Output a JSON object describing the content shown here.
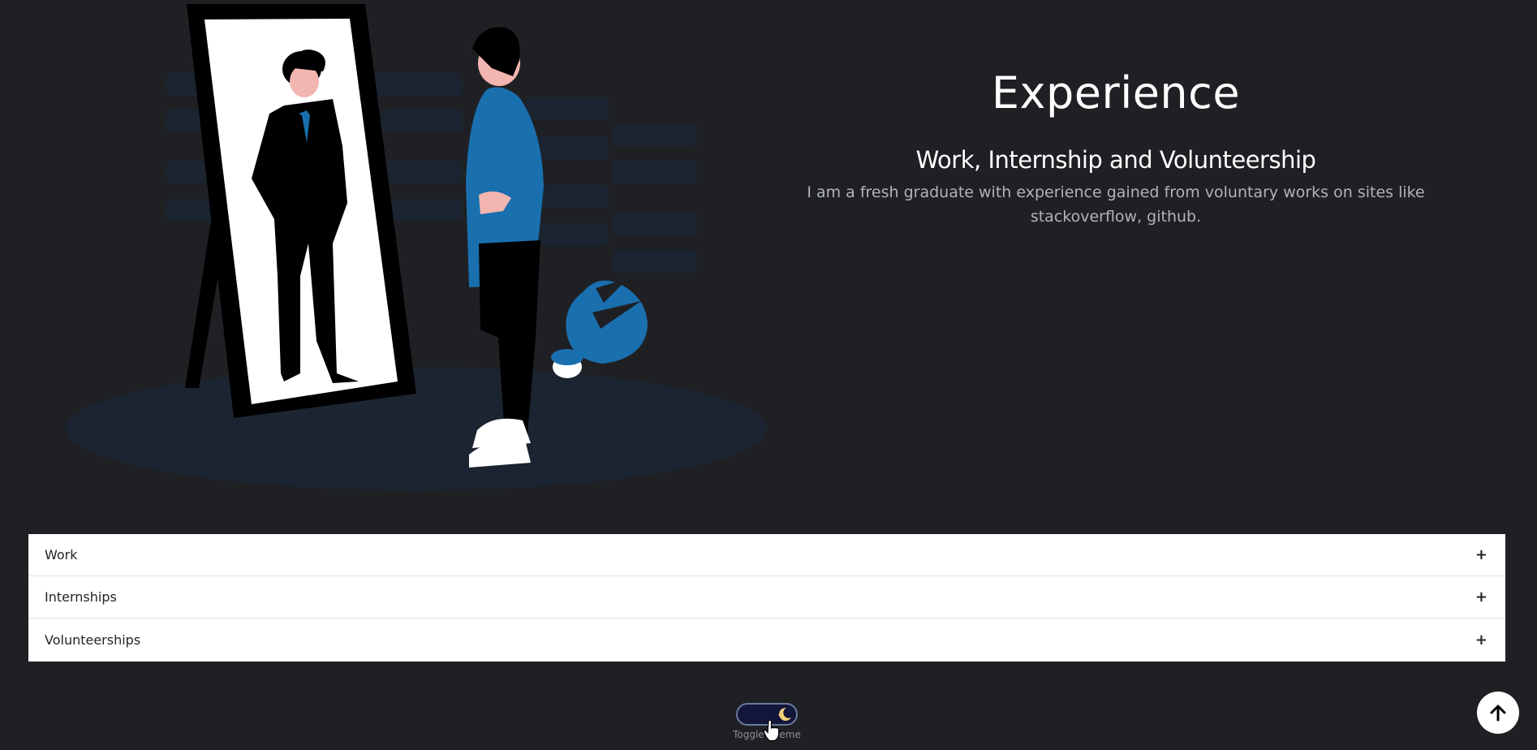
{
  "hero": {
    "title": "Experience",
    "subtitle": "Work, Internship and Volunteership",
    "description": "I am a fresh graduate with experience gained from voluntary works on sites like stackoverflow, github."
  },
  "accordion": {
    "items": [
      {
        "label": "Work",
        "toggle": "+"
      },
      {
        "label": "Internships",
        "toggle": "+"
      },
      {
        "label": "Volunteerships",
        "toggle": "+"
      }
    ]
  },
  "theme_toggle": {
    "label": "Toggle Theme",
    "icon": "moon-icon",
    "state": "dark"
  },
  "scroll_top": {
    "icon": "arrow-up-icon"
  },
  "colors": {
    "background": "#1f2024",
    "accent_blue": "#1a6fae",
    "text_muted": "#b0b3b8"
  }
}
